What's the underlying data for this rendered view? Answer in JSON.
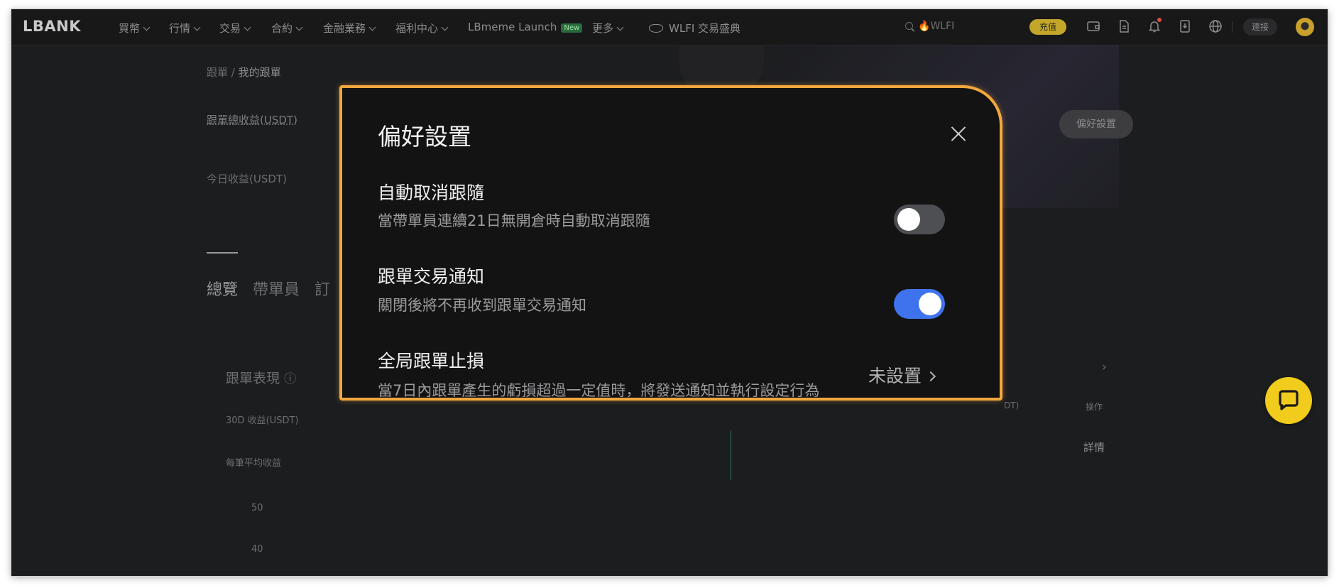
{
  "navbar": {
    "logo": "LBANK",
    "items": [
      {
        "label": "買幣",
        "dropdown": true
      },
      {
        "label": "行情",
        "dropdown": true
      },
      {
        "label": "交易",
        "dropdown": true
      },
      {
        "label": "合約",
        "dropdown": true
      },
      {
        "label": "金融業務",
        "dropdown": true
      },
      {
        "label": "福利中心",
        "dropdown": true
      },
      {
        "label": "LBmeme Launch",
        "badge": "New"
      },
      {
        "label": "更多",
        "dropdown": true
      }
    ],
    "promo": "WLFI 交易盛典",
    "search_text": "WLFI",
    "deposit_label": "充值",
    "connect_label": "連接",
    "icons": [
      "wallet-icon",
      "document-icon",
      "bell-icon",
      "download-icon",
      "globe-icon"
    ]
  },
  "background_page": {
    "breadcrumb": {
      "parent": "跟單",
      "current": "我的跟單"
    },
    "total_profit_label": "跟單總收益(USDT)",
    "today_profit_label": "今日收益(USDT)",
    "preferences_button": "偏好設置",
    "tabs": [
      "總覽",
      "帶單員",
      "訂"
    ],
    "performance_title": "跟單表現",
    "profit_30d_label": "30D 收益(USDT)",
    "avg_profit_label": "每筆平均收益",
    "y_ticks": [
      "50",
      "40"
    ],
    "table": {
      "col_partial": "DT)",
      "action_header": "操作",
      "detail_link": "詳情"
    }
  },
  "modal": {
    "title": "偏好設置",
    "settings": [
      {
        "title": "自動取消跟隨",
        "description": "當帶單員連續21日無開倉時自動取消跟隨",
        "enabled": false
      },
      {
        "title": "跟單交易通知",
        "description": "關閉後將不再收到跟單交易通知",
        "enabled": true
      },
      {
        "title": "全局跟單止損",
        "description": "當7日內跟單產生的虧損超過一定值時，將發送通知並執行設定行為",
        "status": "未設置"
      }
    ]
  },
  "colors": {
    "accent_border": "#f3a73d",
    "toggle_on": "#3f73ee",
    "toggle_off": "#4e4f53",
    "deposit": "#c4a62a",
    "support": "#f2cc1c"
  }
}
